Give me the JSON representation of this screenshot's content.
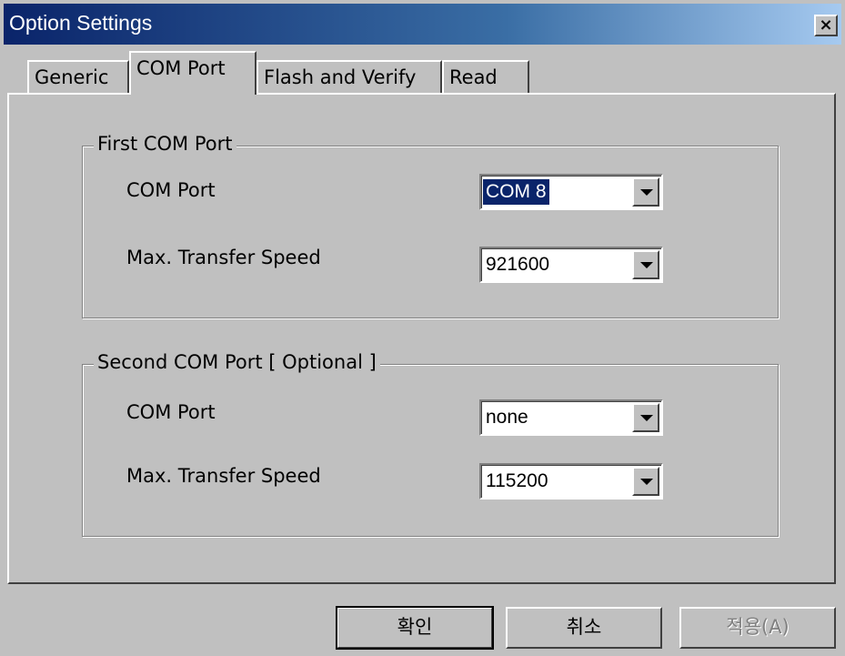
{
  "window": {
    "title": "Option Settings",
    "close_glyph": "×"
  },
  "tabs": [
    {
      "label": "Generic",
      "active": false
    },
    {
      "label": "COM Port",
      "active": true
    },
    {
      "label": "Flash and Verify",
      "active": false
    },
    {
      "label": "Read",
      "active": false
    }
  ],
  "first_group": {
    "legend": "First COM Port",
    "com_port_label": "COM Port",
    "com_port_value": "COM 8",
    "speed_label": "Max. Transfer Speed",
    "speed_value": "921600"
  },
  "second_group": {
    "legend": "Second COM Port [ Optional ]",
    "com_port_label": "COM Port",
    "com_port_value": "none",
    "speed_label": "Max. Transfer Speed",
    "speed_value": "115200"
  },
  "buttons": {
    "ok": "확인",
    "cancel": "취소",
    "apply": "적용(A)",
    "apply_enabled": false
  },
  "colors": {
    "face": "#c0c0c0",
    "title_start": "#0a246a",
    "title_end": "#a6caf0",
    "selection": "#0a246a"
  },
  "icons": [
    "close-icon",
    "dropdown-arrow-icon"
  ]
}
